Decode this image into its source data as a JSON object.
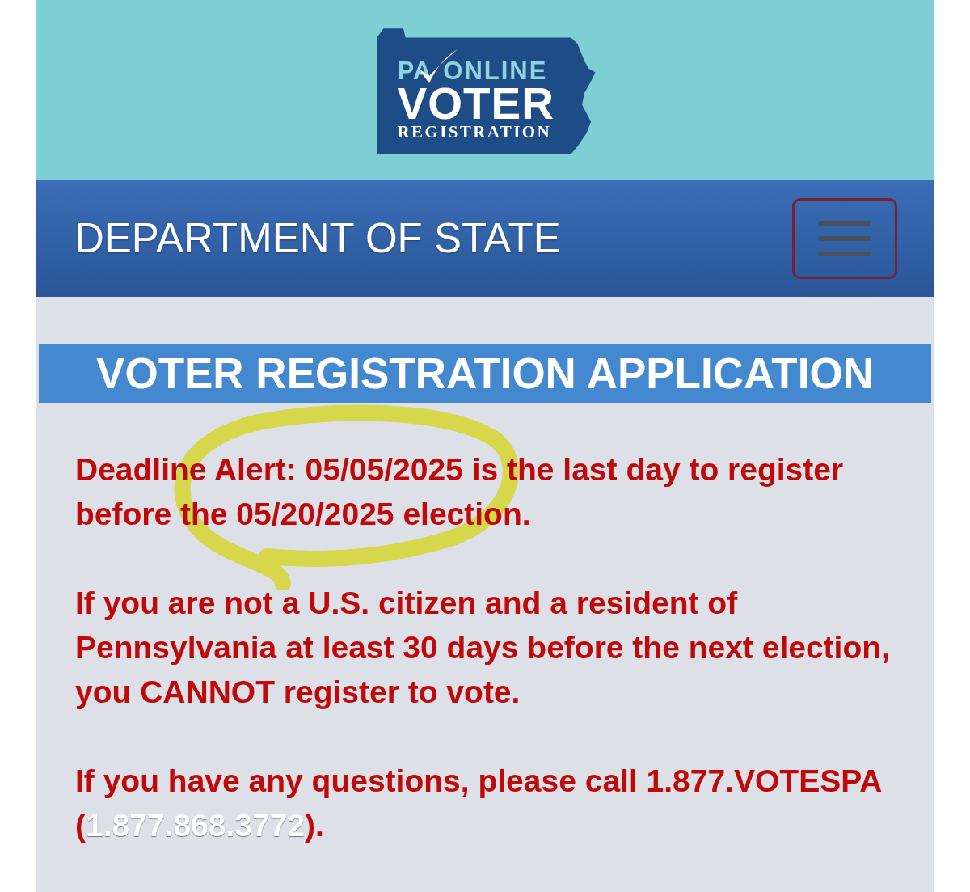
{
  "header": {
    "logo": {
      "prefix": "PA",
      "tagline": "ONLINE",
      "title": "VOTER",
      "subtitle": "REGISTRATION"
    }
  },
  "nav": {
    "title": "DEPARTMENT OF STATE"
  },
  "banner": {
    "title": "VOTER REGISTRATION APPLICATION"
  },
  "notices": [
    {
      "kind": "text",
      "text": "Deadline Alert: 05/05/2025 is the last day to register before the 05/20/2025 election."
    },
    {
      "kind": "text",
      "text": "If you are not a U.S. citizen and a resident of Pennsylvania at least 30 days before the next election, you CANNOT register to vote."
    },
    {
      "kind": "link",
      "text": "If you have any questions, please call 1.877.VOTESPA",
      "before_link": "(",
      "link": "1.877.868.3772",
      "after_link": ")."
    }
  ],
  "annotation": {
    "kind": "circle"
  }
}
